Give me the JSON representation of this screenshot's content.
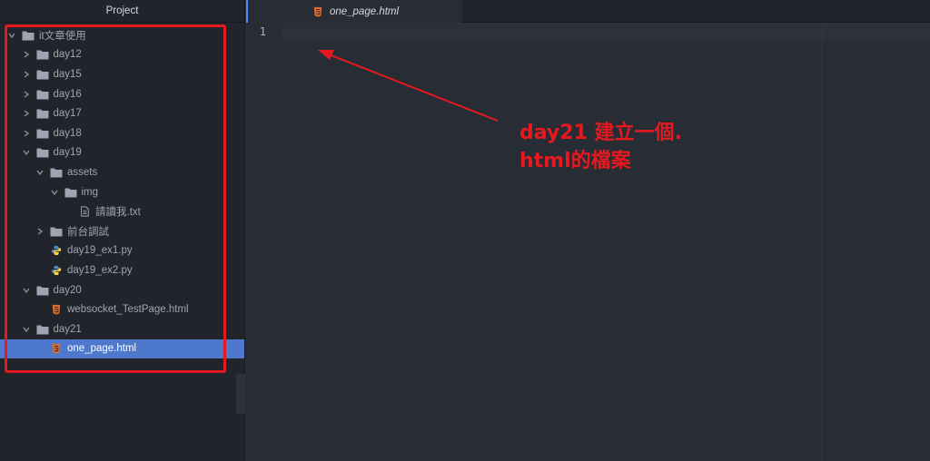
{
  "panel": {
    "title": "Project",
    "tree": [
      {
        "label": "it文章使用",
        "type": "folder",
        "depth": 0,
        "expanded": true
      },
      {
        "label": "day12",
        "type": "folder",
        "depth": 1,
        "expanded": false
      },
      {
        "label": "day15",
        "type": "folder",
        "depth": 1,
        "expanded": false
      },
      {
        "label": "day16",
        "type": "folder",
        "depth": 1,
        "expanded": false
      },
      {
        "label": "day17",
        "type": "folder",
        "depth": 1,
        "expanded": false
      },
      {
        "label": "day18",
        "type": "folder",
        "depth": 1,
        "expanded": false
      },
      {
        "label": "day19",
        "type": "folder",
        "depth": 1,
        "expanded": true
      },
      {
        "label": "assets",
        "type": "folder",
        "depth": 2,
        "expanded": true
      },
      {
        "label": "img",
        "type": "folder",
        "depth": 3,
        "expanded": true
      },
      {
        "label": "請讀我.txt",
        "type": "text-file",
        "depth": 4
      },
      {
        "label": "前台調試",
        "type": "folder",
        "depth": 2,
        "expanded": false
      },
      {
        "label": "day19_ex1.py",
        "type": "python-file",
        "depth": 2
      },
      {
        "label": "day19_ex2.py",
        "type": "python-file",
        "depth": 2
      },
      {
        "label": "day20",
        "type": "folder",
        "depth": 1,
        "expanded": true
      },
      {
        "label": "websocket_TestPage.html",
        "type": "html-file",
        "depth": 2
      },
      {
        "label": "day21",
        "type": "folder",
        "depth": 1,
        "expanded": true
      },
      {
        "label": "one_page.html",
        "type": "html-file",
        "depth": 2,
        "selected": true
      }
    ]
  },
  "tab": {
    "label": "one_page.html",
    "icon": "html5-icon"
  },
  "editor": {
    "line_number": "1"
  },
  "annotation": {
    "line1": "day21 建立一個.",
    "line2": "html的檔案",
    "color": "#e5191f"
  },
  "colors": {
    "sidebar_bg": "#21252b",
    "editor_bg": "#282c34",
    "selection": "#4d78cc",
    "html_icon": "#e06b2a",
    "python_icon": "#4b8bbe"
  }
}
